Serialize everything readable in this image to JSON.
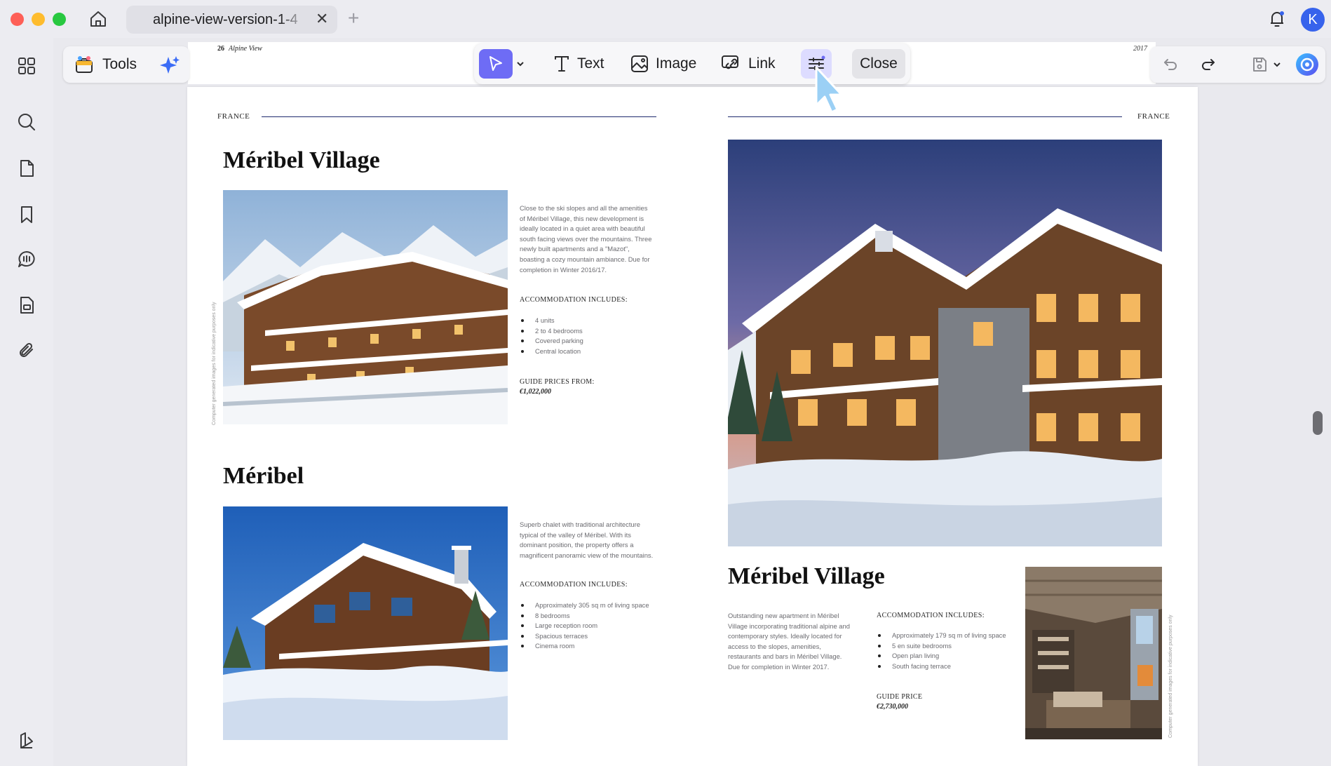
{
  "window": {
    "tab_title": "alpine-view-version-1-4",
    "tab_close": "✕",
    "new_tab": "+",
    "avatar_letter": "K"
  },
  "toolbar": {
    "tools_label": "Tools",
    "text_label": "Text",
    "image_label": "Image",
    "link_label": "Link",
    "close_label": "Close",
    "accent_color": "#6e6cf5"
  },
  "document": {
    "running_head": {
      "page_number": "26",
      "title": "Alpine View"
    },
    "year": "2017",
    "left_page": {
      "country": "FRANCE",
      "listing1": {
        "title": "Méribel Village",
        "description": "Close to the ski slopes and all the amenities of Méribel Village, this new development is ideally located in a quiet area with beautiful south facing views over the mountains. Three newly built apartments and a \"Mazot\", boasting a cozy mountain ambiance. Due for completion in Winter 2016/17.",
        "accommodation_heading": "ACCOMMODATION INCLUDES:",
        "accommodation": [
          "4 units",
          "2 to 4 bedrooms",
          "Covered parking",
          "Central location"
        ],
        "price_heading": "GUIDE PRICES FROM:",
        "price": "€1,022,000",
        "side_caption": "Computer generated images for indicative purposes only"
      },
      "listing2": {
        "title": "Méribel",
        "description": "Superb chalet with traditional architecture typical of the valley of Méribel. With its dominant position, the property offers a magnificent panoramic view of the mountains.",
        "accommodation_heading": "ACCOMMODATION INCLUDES:",
        "accommodation": [
          "Approximately 305 sq m of living space",
          "8 bedrooms",
          "Large reception room",
          "Spacious terraces",
          "Cinema room"
        ]
      }
    },
    "right_page": {
      "country": "FRANCE",
      "listing": {
        "title": "Méribel Village",
        "description": "Outstanding new apartment in Méribel Village incorporating traditional alpine and contemporary styles. Ideally located for access to the slopes, amenities, restaurants and bars in Méribel Village. Due for completion in Winter 2017.",
        "accommodation_heading": "ACCOMMODATION INCLUDES:",
        "accommodation": [
          "Approximately 179 sq m of living space",
          "5 en suite bedrooms",
          "Open plan living",
          "South facing terrace"
        ],
        "price_heading": "GUIDE PRICE",
        "price": "€2,730,000",
        "side_caption": "Computer generated images for indicative purposes only"
      }
    }
  }
}
